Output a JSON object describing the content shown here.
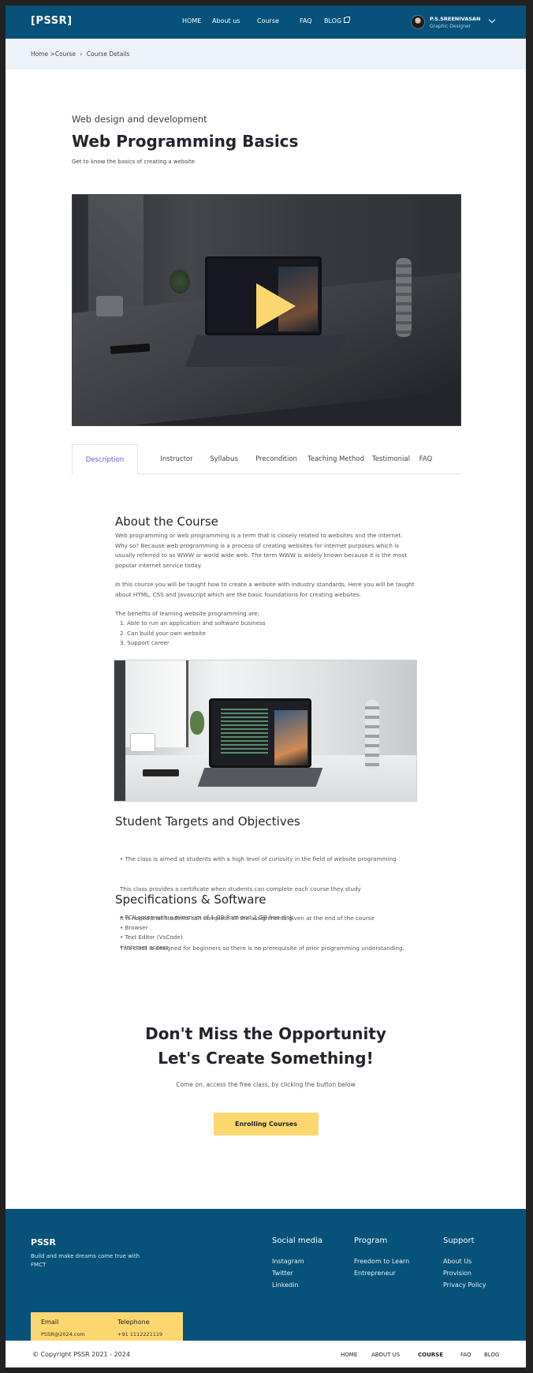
{
  "header": {
    "logo": "[PSSR]",
    "nav": [
      "HOME",
      "About us",
      "Course",
      "FAQ",
      "BLOG"
    ],
    "user_name": "P.S.SREENIVASAN",
    "user_role": "Graphic Designer"
  },
  "breadcrumb": [
    "Home",
    ">Course",
    "›",
    "Course Details"
  ],
  "hero": {
    "eyebrow": "Web design and development",
    "title": "Web Programming Basics",
    "subtitle": "Get to know the basics of creating a website"
  },
  "tabs": [
    "Description",
    "Instructor",
    "Syllabus",
    "Precondition",
    "Teaching Method",
    "Testimonial",
    "FAQ"
  ],
  "about": {
    "heading": "About the Course",
    "p1": "Web programming or web programming is a term that is closely related to websites and the internet. Why so? Because web programming is a process of creating websites for internet purposes which is usually referred to as WWW or world wide web. The term WWW is widely known because it is the most popular internet service today.",
    "p2": "In this course you will be taught how to create a website with industry standards. Here you will be taught about HTML, CSS and Javascript which are the basic foundations for creating websites.",
    "benefits_intro": "The benefits of learning website programming are;",
    "benefits": [
      "1. Able to run an application and software business",
      "2. Can build your own website",
      "3. Support career"
    ]
  },
  "targets": {
    "heading": "Student Targets and Objectives",
    "items": [
      "•  The class is aimed at students with a high level of curiosity in the field of website programming",
      "    This class provides a certificate when students can complete each course they study",
      "    It is hoped that students can complete all the assignments given at the end of the course",
      "    This class is designed for beginners so there is no prerequisite of prior programming understanding."
    ]
  },
  "specs": {
    "heading": "Specifications & Software",
    "items": [
      "•  PC/Laptop with a minimum of 1 GB Ram and 2 GB free disk",
      "•  Browser",
      "•  Text Editor (VsCode)",
      "•  Internet access"
    ]
  },
  "cta": {
    "line1": "Don't Miss the Opportunity",
    "line2": "Let's Create Something!",
    "sub": "Come on, access the free class, by clicking the button below",
    "button": "Enrolling Courses"
  },
  "footer": {
    "logo": "PSSR",
    "tagline": "Build and make dreams come true with FMCT",
    "social_head": "Social media",
    "social": [
      "Instagram",
      "Twitter",
      "Linkedin"
    ],
    "program_head": "Program",
    "program": [
      "Freedom to Learn",
      "Entrepreneur"
    ],
    "support_head": "Support",
    "support": [
      "About Us",
      "Provision",
      "Privacy Policy"
    ],
    "email_label": "Email",
    "email": "PSSR@2024.com",
    "phone_label": "Telephone",
    "phone": "+91 1112221119",
    "copyright": "© Copyright PSSR 2021 - 2024",
    "bottom_nav": [
      "HOME",
      "ABOUT US",
      "COURSE",
      "FAQ",
      "BLOG"
    ]
  },
  "colors": {
    "brand_blue": "#06527a",
    "accent_yellow": "#fcd770",
    "tab_active": "#5a5fd0"
  },
  "icons": [
    "external-link-icon",
    "chevron-down-icon",
    "play-icon"
  ]
}
